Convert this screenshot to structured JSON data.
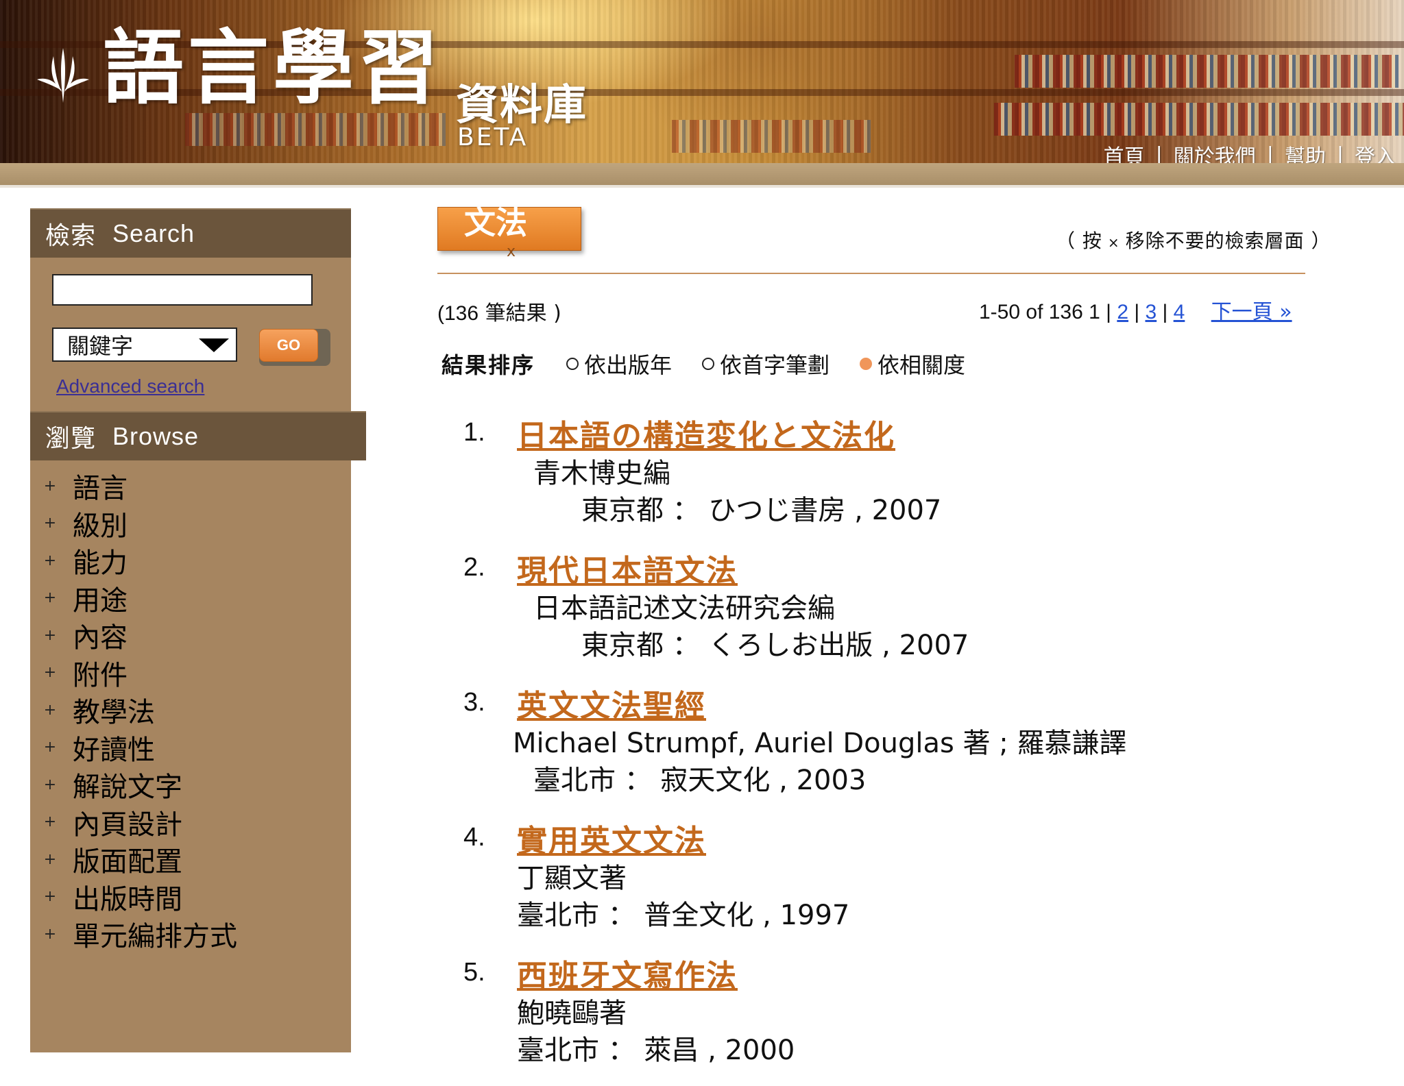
{
  "header": {
    "logo_title": "語言學習",
    "logo_sub": "資料庫",
    "logo_beta": "BETA",
    "nav": [
      "首頁",
      "關於我們",
      "幫助",
      "登入"
    ]
  },
  "sidebar": {
    "search_title": "檢索",
    "search_title_en": "Search",
    "search_input_value": "",
    "select_value": "關鍵字",
    "go_label": "GO",
    "advanced_label": "Advanced search",
    "browse_title": "瀏覽",
    "browse_title_en": "Browse",
    "browse_items": [
      "語言",
      "級別",
      "能力",
      "用途",
      "內容",
      "附件",
      "教學法",
      "好讀性",
      "解說文字",
      "內頁設計",
      "版面配置",
      "出版時間",
      "單元編排方式"
    ]
  },
  "main": {
    "facet_label": "文法",
    "facet_remove": "x",
    "remove_hint_open": "（ 按",
    "remove_hint_x": "×",
    "remove_hint_rest": "移除不要的檢索層面 ）",
    "result_count_prefix": "(",
    "result_count_num": "136",
    "result_count_suffix": " 筆結果 )",
    "pager": {
      "range": "1-50 of 136",
      "current": "1",
      "pages": [
        "2",
        "3",
        "4"
      ],
      "next": "下一頁 »"
    },
    "sort": {
      "label": "結果排序",
      "options": [
        "依出版年",
        "依首字筆劃",
        "依相關度"
      ],
      "selected": "依相關度"
    },
    "results": [
      {
        "num": "1.",
        "title": "日本語の構造変化と文法化",
        "author": "青木博史編",
        "pub": "東京都 ： ひつじ書房 , 2007"
      },
      {
        "num": "2.",
        "title": "現代日本語文法 ",
        "author": "日本語記述文法研究会編",
        "pub": "東京都 ： くろしお出版 , 2007"
      },
      {
        "num": "3.",
        "title": "英文文法聖經 ",
        "author": "Michael Strumpf, Auriel Douglas 著 ; 羅慕謙譯",
        "pub": "臺北市 ： 寂天文化 , 2003"
      },
      {
        "num": "4.",
        "title": "實用英文文法",
        "author": "丁顯文著",
        "pub": "臺北市 ： 普全文化 , 1997"
      },
      {
        "num": "5.",
        "title": "西班牙文寫作法",
        "author": "鮑曉鷗著",
        "pub": "臺北市 ： 萊昌 , 2000"
      }
    ]
  }
}
